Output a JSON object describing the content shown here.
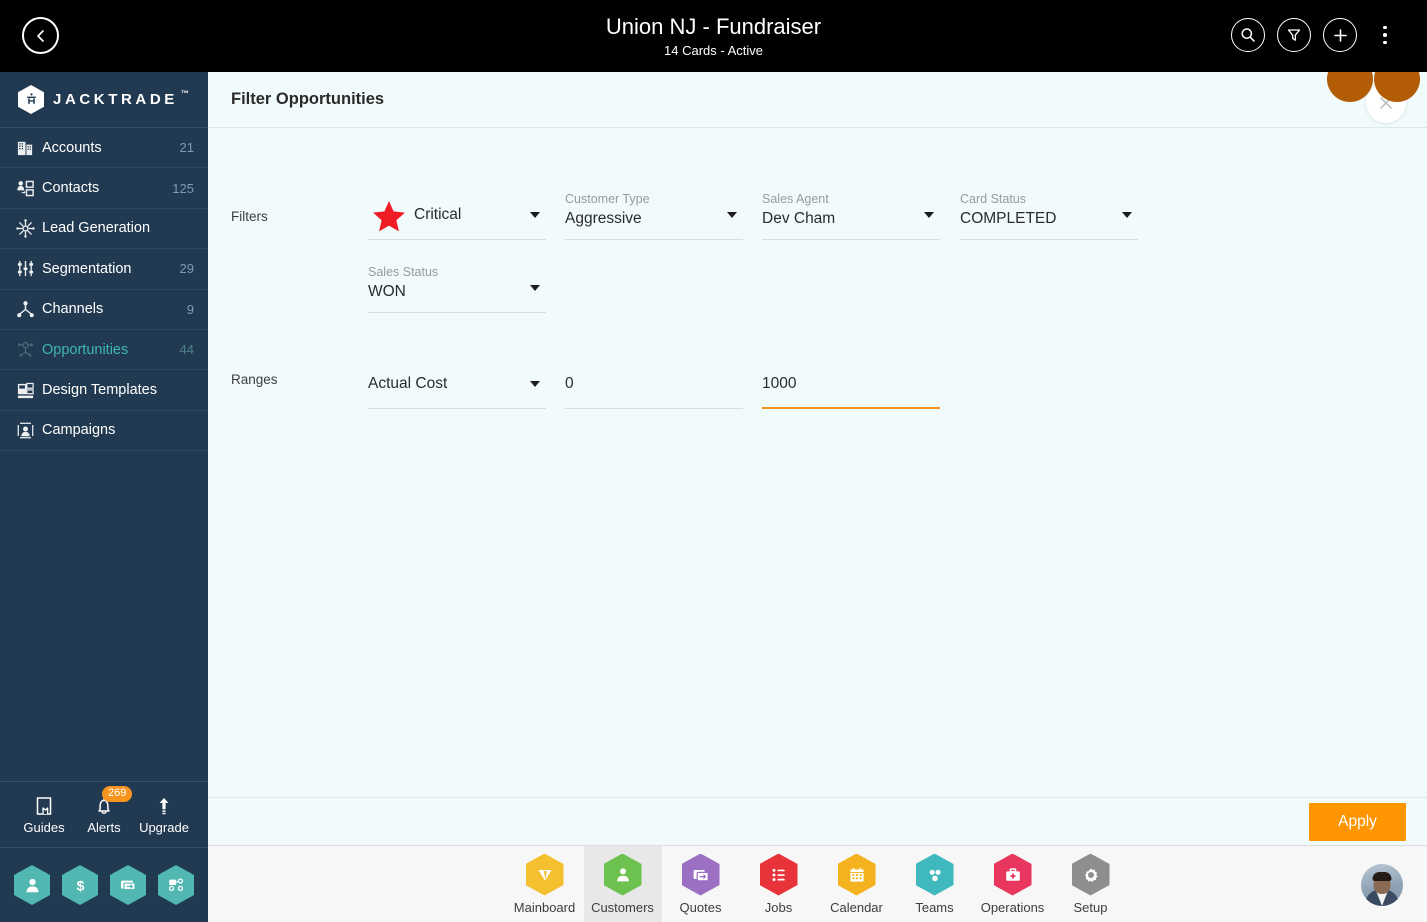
{
  "topbar": {
    "title": "Union NJ - Fundraiser",
    "subtitle": "14 Cards - Active",
    "back_icon": "chevron-left-icon",
    "actions": [
      {
        "name": "search-icon",
        "label": "Search"
      },
      {
        "name": "filter-icon",
        "label": "Filter"
      },
      {
        "name": "add-icon",
        "label": "Add"
      },
      {
        "name": "more-vertical-icon",
        "label": "More"
      }
    ]
  },
  "sidebar": {
    "brand": "JACKTRADE",
    "brand_tm": "™",
    "items": [
      {
        "label": "Accounts",
        "count": "21",
        "icon": "building-icon",
        "active": false
      },
      {
        "label": "Contacts",
        "count": "125",
        "icon": "contacts-icon",
        "active": false
      },
      {
        "label": "Lead Generation",
        "count": "",
        "icon": "lead-gen-icon",
        "active": false
      },
      {
        "label": "Segmentation",
        "count": "29",
        "icon": "segmentation-icon",
        "active": false
      },
      {
        "label": "Channels",
        "count": "9",
        "icon": "channels-icon",
        "active": false
      },
      {
        "label": "Opportunities",
        "count": "44",
        "icon": "opportunities-icon",
        "active": true
      },
      {
        "label": "Design Templates",
        "count": "",
        "icon": "templates-icon",
        "active": false
      },
      {
        "label": "Campaigns",
        "count": "",
        "icon": "campaigns-icon",
        "active": false
      }
    ],
    "footer": [
      {
        "label": "Guides",
        "icon": "book-icon",
        "badge": ""
      },
      {
        "label": "Alerts",
        "icon": "bell-icon",
        "badge": "269"
      },
      {
        "label": "Upgrade",
        "icon": "arrow-up-icon",
        "badge": ""
      }
    ],
    "quick_icons": [
      {
        "name": "person-hex-icon"
      },
      {
        "name": "dollar-hex-icon"
      },
      {
        "name": "payment-hex-icon"
      },
      {
        "name": "workflow-hex-icon"
      }
    ]
  },
  "panel": {
    "title": "Filter Opportunities",
    "close_icon": "close-icon",
    "filters_label": "Filters",
    "ranges_label": "Ranges",
    "filters": [
      {
        "label": "",
        "value": "Critical",
        "icon": "star-icon",
        "focused": false
      },
      {
        "label": "Customer Type",
        "value": "Aggressive",
        "icon": "",
        "focused": false
      },
      {
        "label": "Sales Agent",
        "value": "Dev Cham",
        "icon": "",
        "focused": false
      },
      {
        "label": "Card Status",
        "value": "COMPLETED",
        "icon": "",
        "focused": false
      },
      {
        "label": "Sales Status",
        "value": "WON",
        "icon": "",
        "focused": false
      }
    ],
    "ranges": {
      "metric": "Actual Cost",
      "min_value": "0",
      "max_value": "1000",
      "max_focused": true
    },
    "apply_label": "Apply"
  },
  "bottomnav": {
    "items": [
      {
        "label": "Mainboard",
        "color": "#f5c030",
        "icon": "mainboard-icon",
        "selected": false
      },
      {
        "label": "Customers",
        "color": "#6cc14f",
        "icon": "customers-icon",
        "selected": true
      },
      {
        "label": "Quotes",
        "color": "#9b6fc4",
        "icon": "quotes-icon",
        "selected": false
      },
      {
        "label": "Jobs",
        "color": "#e8333a",
        "icon": "jobs-icon",
        "selected": false
      },
      {
        "label": "Calendar",
        "color": "#f5b21f",
        "icon": "calendar-icon",
        "selected": false
      },
      {
        "label": "Teams",
        "color": "#3fb9bd",
        "icon": "teams-icon",
        "selected": false
      },
      {
        "label": "Operations",
        "color": "#e8365e",
        "icon": "operations-icon",
        "selected": false
      },
      {
        "label": "Setup",
        "color": "#8e8e8e",
        "icon": "setup-icon",
        "selected": false
      }
    ],
    "avatar": "user-avatar"
  },
  "colors": {
    "accent_orange": "#ff9500",
    "sidebar_bg": "#223a51",
    "panel_bg": "#f1fbfb",
    "active_teal": "#3fb6b0",
    "critical_red": "#ef1c25"
  }
}
